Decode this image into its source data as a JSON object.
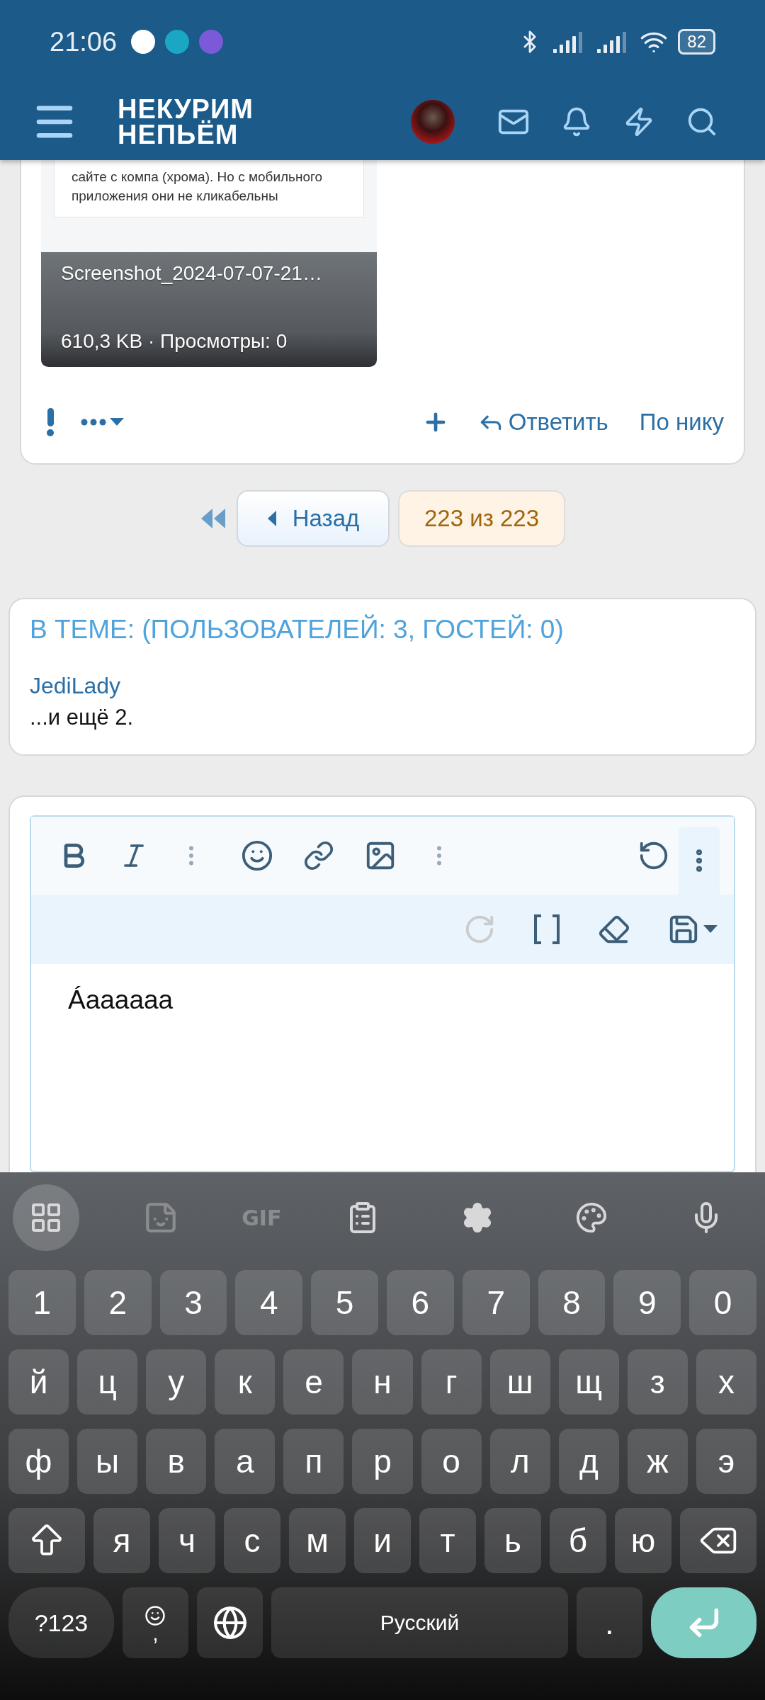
{
  "status_bar": {
    "time": "21:06",
    "battery": "82"
  },
  "header": {
    "logo_lines": [
      "НЕКУРИМ",
      "НЕПЬЁМ"
    ]
  },
  "post": {
    "attachment": {
      "screenshot_lines": [
        "сайте с компа (хрома). Но с мобильного",
        "приложения они не кликабельны"
      ],
      "filename": "Screenshot_2024-07-07-21…",
      "meta": "610,3 KB · Просмотры: 0"
    },
    "reply": "Ответить",
    "by_nick": "По нику"
  },
  "pagination": {
    "back": "Назад",
    "page": "223 из 223"
  },
  "online": {
    "title": "В ТЕМЕ: (ПОЛЬЗОВАТЕЛЕЙ: 3, ГОСТЕЙ: 0)",
    "users": [
      "JediLady"
    ],
    "more": "...и ещё 2."
  },
  "editor": {
    "more_expanded": true,
    "redo_disabled": true,
    "content": "Áaaaaaa"
  },
  "keyboard": {
    "gif": "GIF",
    "rows": [
      {
        "kind": "digits",
        "keys": [
          "1",
          "2",
          "3",
          "4",
          "5",
          "6",
          "7",
          "8",
          "9",
          "0"
        ]
      },
      {
        "kind": "letters",
        "keys": [
          "й",
          "ц",
          "у",
          "к",
          "е",
          "н",
          "г",
          "ш",
          "щ",
          "з",
          "х"
        ]
      },
      {
        "kind": "letters",
        "keys": [
          "ф",
          "ы",
          "в",
          "а",
          "п",
          "р",
          "о",
          "л",
          "д",
          "ж",
          "э"
        ]
      },
      {
        "kind": "edit",
        "keys": [
          "я",
          "ч",
          "с",
          "м",
          "и",
          "т",
          "ь",
          "б",
          "ю"
        ]
      }
    ],
    "symbols": "?123",
    "comma": ",",
    "space": "Русский",
    "period": "."
  }
}
